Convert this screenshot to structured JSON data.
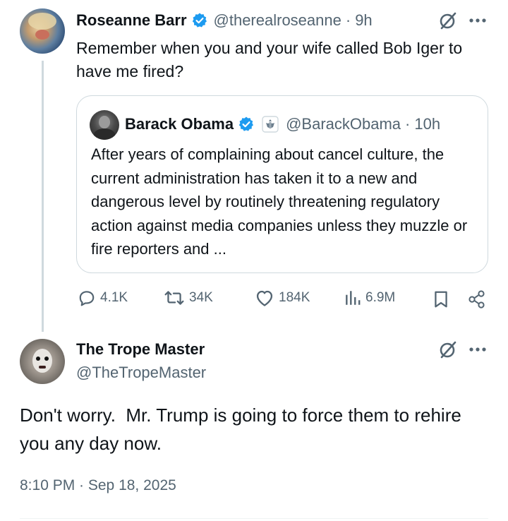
{
  "tweet": {
    "author_name": "Roseanne Barr",
    "author_handle": "@therealroseanne",
    "separator": "·",
    "time": "9h",
    "text": "Remember when you and your wife called Bob Iger to have me fired?"
  },
  "quote": {
    "author_name": "Barack Obama",
    "author_handle": "@BarackObama",
    "separator": "·",
    "time": "10h",
    "text": "After years of complaining about cancel culture, the current administration has taken it to a new and dangerous level by routinely threatening regulatory action against media companies unless they muzzle or fire reporters and ..."
  },
  "actions": {
    "replies": "4.1K",
    "reposts": "34K",
    "likes": "184K",
    "views": "6.9M"
  },
  "reply": {
    "author_name": "The Trope Master",
    "author_handle": "@TheTropeMaster",
    "text": "Don't worry.  Mr. Trump is going to force them to rehire you any day now.",
    "timestamp": "8:10 PM · Sep 18, 2025"
  },
  "colors": {
    "verified": "#1d9bf0",
    "secondary_text": "#536471",
    "border": "#cfd9de"
  },
  "icons": [
    "grok-icon",
    "more-icon",
    "verified-badge-icon",
    "government-seal-icon",
    "reply-icon",
    "repost-icon",
    "like-icon",
    "views-icon",
    "bookmark-icon",
    "share-icon"
  ]
}
